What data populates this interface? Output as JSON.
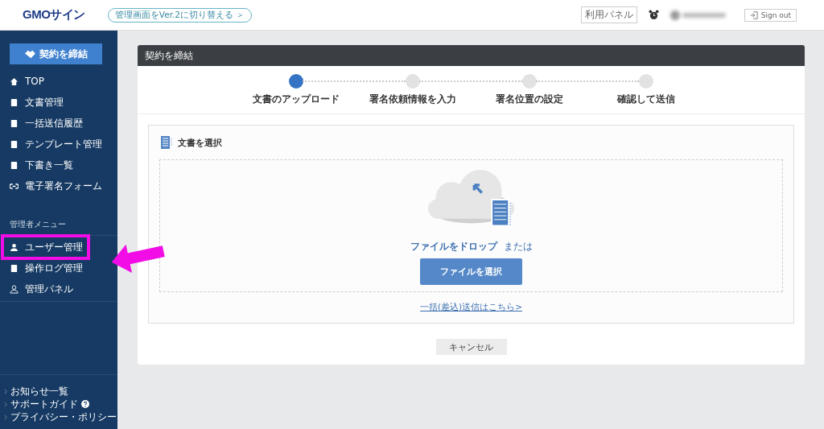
{
  "header": {
    "logo": "GMOサイン",
    "switch_link": "管理画面をVer.2に切り替える ＞",
    "panel_button": "利用パネル",
    "signout_button": "Sign out"
  },
  "sidebar": {
    "primary_button": "契約を締結",
    "items": [
      {
        "label": "TOP",
        "highlighted": false
      },
      {
        "label": "文書管理",
        "highlighted": false
      },
      {
        "label": "一括送信履歴",
        "highlighted": false
      },
      {
        "label": "テンプレート管理",
        "highlighted": false
      },
      {
        "label": "下書き一覧",
        "highlighted": false
      },
      {
        "label": "電子署名フォーム",
        "highlighted": false
      }
    ],
    "admin_heading": "管理者メニュー",
    "admin_items": [
      {
        "label": "ユーザー管理",
        "highlighted": true
      },
      {
        "label": "操作ログ管理",
        "highlighted": false
      },
      {
        "label": "管理パネル",
        "highlighted": false
      }
    ],
    "footer_links": [
      {
        "label": "お知らせ一覧",
        "help": false
      },
      {
        "label": "サポートガイド",
        "help": true
      },
      {
        "label": "プライバシー・ポリシー",
        "help": false
      }
    ]
  },
  "card": {
    "title": "契約を締結",
    "steps": [
      {
        "label": "文書のアップロード",
        "selected": true
      },
      {
        "label": "署名依頼情報を入力",
        "selected": false
      },
      {
        "label": "署名位置の設定",
        "selected": false
      },
      {
        "label": "確認して送信",
        "selected": false
      }
    ],
    "section_title": "文書を選択",
    "drop_text": "ファイルをドロップ",
    "or_text": "または",
    "select_button": "ファイルを選択",
    "bulk_link": "一括(差込)送信はこちら>"
  },
  "cancel_button": "キャンセル"
}
